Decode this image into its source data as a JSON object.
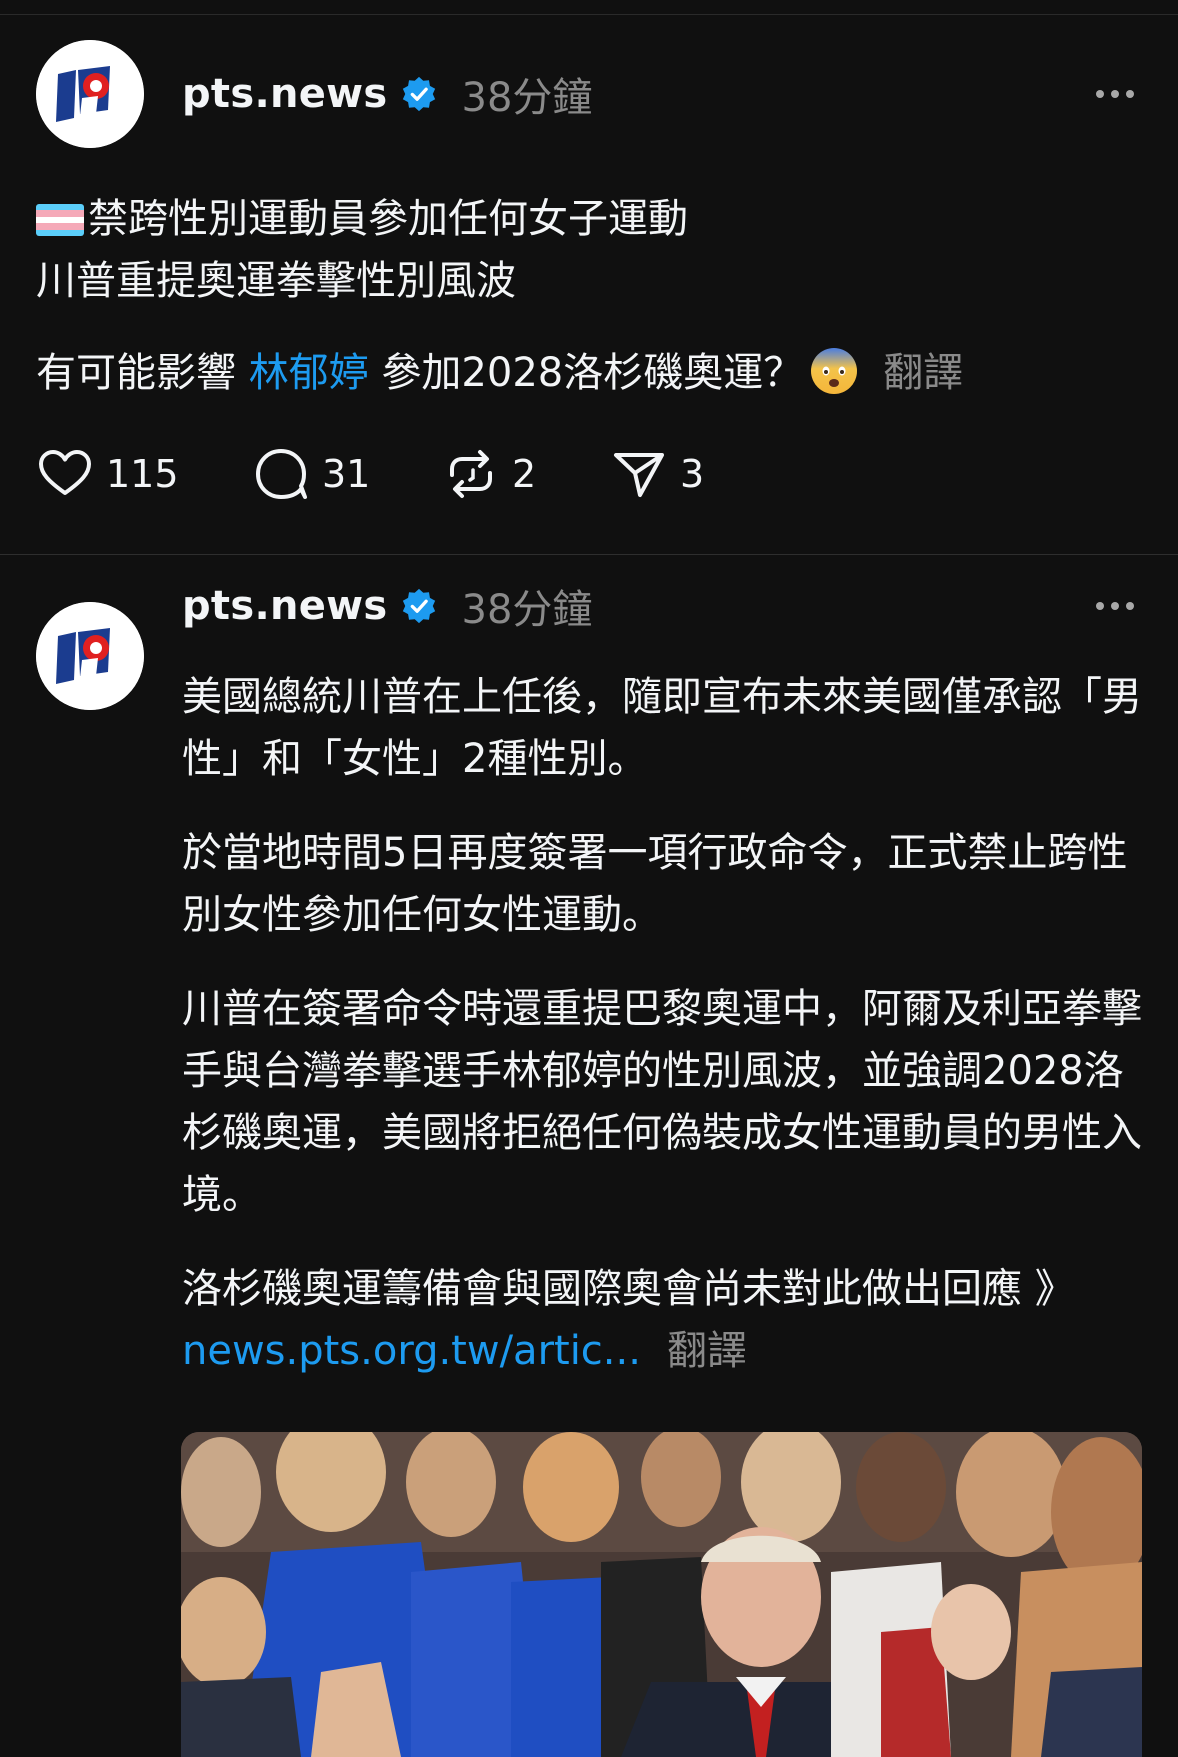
{
  "post1": {
    "username": "pts.news",
    "time": "38分鐘",
    "line1": "禁跨性別運動員參加任何女子運動",
    "line2": "川普重提奧運拳擊性別風波",
    "line3_prefix": "有可能影響 ",
    "mention": "林郁婷",
    "line3_suffix": " 參加2028洛杉磯奧運？",
    "translate": "翻譯",
    "likes": "115",
    "replies": "31",
    "reposts": "2",
    "shares": "3"
  },
  "post2": {
    "username": "pts.news",
    "time": "38分鐘",
    "para1": "美國總統川普在上任後，隨即宣布未來美國僅承認「男性」和「女性」2種性別。",
    "para2": "於當地時間5日再度簽署一項行政命令，正式禁止跨性別女性參加任何女性運動。",
    "para3": "川普在簽署命令時還重提巴黎奧運中，阿爾及利亞拳擊手與台灣拳擊選手林郁婷的性別風波，並強調2028洛杉磯奧運，美國將拒絕任何偽裝成女性運動員的男性入境。",
    "para4": "洛杉磯奧運籌備會與國際奧會尚未對此做出回應 》",
    "link": "news.pts.org.tw/artic...",
    "translate": "翻譯"
  },
  "icons": {
    "verified": "verified-badge-icon",
    "more": "more-options-icon",
    "like": "heart-icon",
    "reply": "comment-icon",
    "repost": "repost-icon",
    "share": "send-icon",
    "flag": "transgender-flag-icon",
    "emoji": "fearful-face-emoji-icon"
  },
  "colors": {
    "background": "#101010",
    "text": "#f3f5f7",
    "secondary": "#8a8a8a",
    "link": "#1d9bf0"
  }
}
